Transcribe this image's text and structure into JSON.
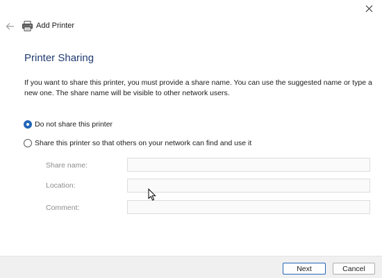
{
  "window": {
    "title": "Add Printer",
    "close_icon": "close-icon",
    "back_icon": "back-arrow-icon",
    "printer_icon": "printer-icon"
  },
  "page": {
    "heading": "Printer Sharing",
    "description": "If you want to share this printer, you must provide a share name. You can use the suggested name or type a new one. The share name will be visible to other network users."
  },
  "sharing_options": [
    {
      "label": "Do not share this printer",
      "selected": true
    },
    {
      "label": "Share this printer so that others on your network can find and use it",
      "selected": false
    }
  ],
  "fields": {
    "share_name": {
      "label": "Share name:",
      "value": ""
    },
    "location": {
      "label": "Location:",
      "value": ""
    },
    "comment": {
      "label": "Comment:",
      "value": ""
    }
  },
  "buttons": {
    "next": "Next",
    "cancel": "Cancel"
  },
  "colors": {
    "accent": "#2266b8",
    "heading": "#1f3a6e",
    "footer": "#f0f0f0"
  }
}
